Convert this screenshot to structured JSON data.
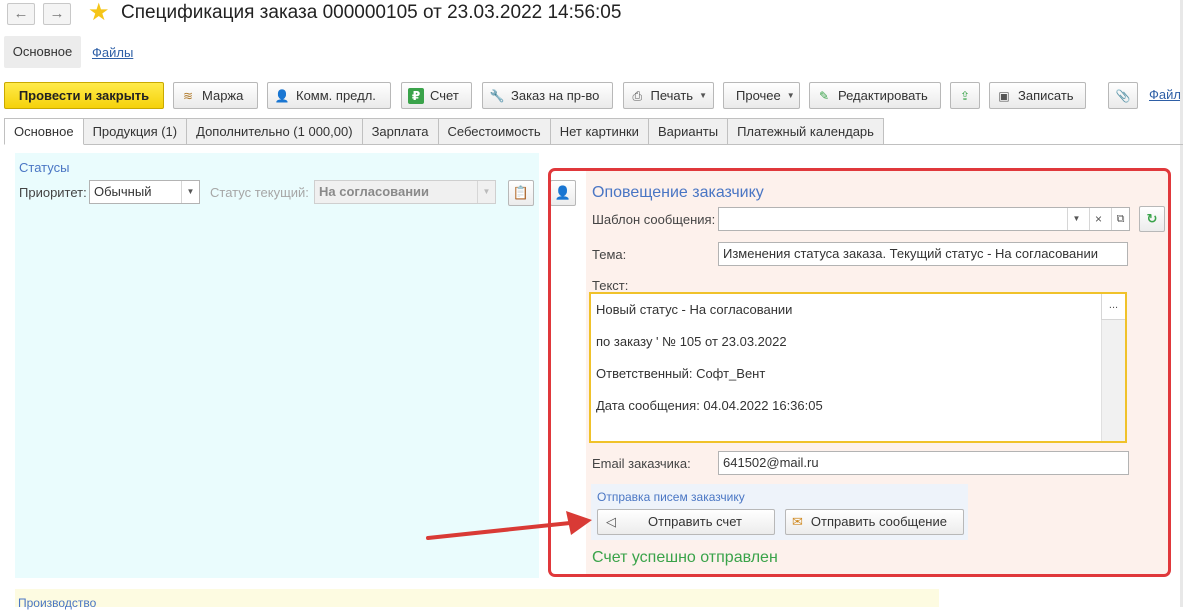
{
  "window": {
    "title": "Спецификация заказа 000000105 от 23.03.2022 14:56:05",
    "back_glyph": "←",
    "forward_glyph": "→"
  },
  "sections": {
    "main": "Основное",
    "files": "Файлы"
  },
  "toolbar": {
    "post_close": "Провести и закрыть",
    "marzha": "Маржа",
    "komm_predl": "Комм. предл.",
    "schet": "Счет",
    "zakaz_prvo": "Заказ на пр-во",
    "pechat": "Печать",
    "prochee": "Прочее",
    "redaktirovat": "Редактировать",
    "zapisat": "Записать",
    "files_link": "Файлы"
  },
  "tabs": [
    {
      "label": "Основное",
      "active": true
    },
    {
      "label": "Продукция (1)"
    },
    {
      "label": "Дополнительно (1 000,00)"
    },
    {
      "label": "Зарплата"
    },
    {
      "label": "Себестоимость"
    },
    {
      "label": "Нет картинки"
    },
    {
      "label": "Варианты"
    },
    {
      "label": "Платежный календарь"
    }
  ],
  "statuses": {
    "group_title": "Статусы",
    "priority_label": "Приоритет:",
    "priority_value": "Обычный",
    "current_status_label": "Статус текущий:",
    "current_status_value": "На согласовании"
  },
  "notification": {
    "title": "Оповещение заказчику",
    "template_label": "Шаблон сообщения:",
    "template_value": "",
    "template_clear_glyph": "×",
    "subject_label": "Тема:",
    "subject_value": "Изменения статуса заказа. Текущий статус - На согласовании",
    "text_label": "Текст:",
    "text_more_glyph": "...",
    "text_lines": [
      "Новый статус - На согласовании",
      "по заказу ' № 105 от 23.03.2022",
      "Ответственный: Софт_Вент",
      "Дата сообщения: 04.04.2022 16:36:05"
    ],
    "email_label": "Email заказчика:",
    "email_value": "641502@mail.ru",
    "send_group_title": "Отправка писем заказчику",
    "send_invoice": "Отправить счет",
    "send_message": "Отправить сообщение",
    "success_text": "Счет успешно отправлен"
  },
  "production": {
    "title": "Производство"
  },
  "colors": {
    "accent_blue": "#4a76c4",
    "primary_yellow": "#f5d20a",
    "highlight_red": "#e0383b",
    "arrow_red": "#d93a35",
    "success_green": "#3aa34a"
  }
}
